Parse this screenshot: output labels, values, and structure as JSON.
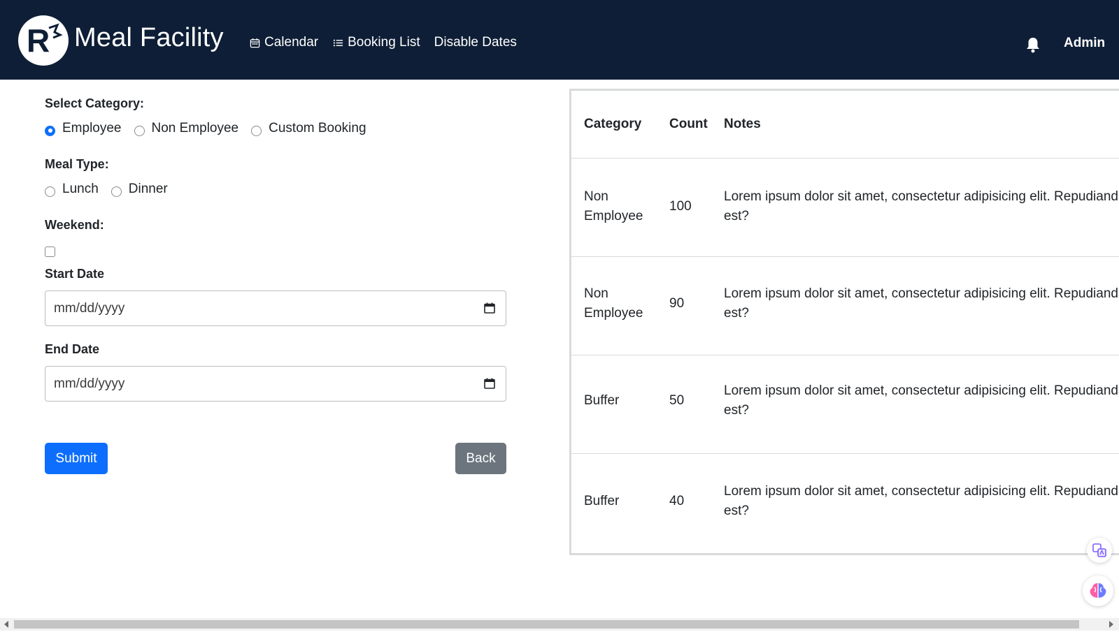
{
  "header": {
    "logo_letter": "R",
    "brand": "Meal Facility",
    "nav": [
      {
        "label": "Calendar",
        "icon": "calendar-icon"
      },
      {
        "label": "Booking List",
        "icon": "list-icon"
      },
      {
        "label": "Disable Dates",
        "icon": ""
      }
    ],
    "user": "Admin",
    "bg_color": "#0e1e36"
  },
  "form": {
    "category_label": "Select Category:",
    "categories": [
      {
        "label": "Employee",
        "checked": true
      },
      {
        "label": "Non Employee",
        "checked": false
      },
      {
        "label": "Custom Booking",
        "checked": false
      }
    ],
    "meal_label": "Meal Type:",
    "meals": [
      {
        "label": "Lunch",
        "checked": false
      },
      {
        "label": "Dinner",
        "checked": false
      }
    ],
    "weekend_label": "Weekend:",
    "weekend_checked": false,
    "start_label": "Start Date",
    "start_value": "mm/dd/yyyy",
    "end_label": "End Date",
    "end_value": "mm/dd/yyyy",
    "submit_label": "Submit",
    "back_label": "Back",
    "primary_color": "#0d6efd",
    "secondary_color": "#6c757d"
  },
  "table": {
    "headers": [
      "Category",
      "Count",
      "Notes"
    ],
    "rows": [
      {
        "category": [
          "Non",
          "Employee"
        ],
        "count": "100",
        "notes": [
          "Lorem ipsum dolor sit amet, consectetur adipisicing elit. Repudiandae",
          "est?"
        ]
      },
      {
        "category": [
          "Non",
          "Employee"
        ],
        "count": "90",
        "notes": [
          "Lorem ipsum dolor sit amet, consectetur adipisicing elit. Repudiandae",
          "est?"
        ]
      },
      {
        "category": [
          "Buffer"
        ],
        "count": "50",
        "notes": [
          "Lorem ipsum dolor sit amet, consectetur adipisicing elit. Repudiandae",
          "est?"
        ]
      },
      {
        "category": [
          "Buffer"
        ],
        "count": "40",
        "notes": [
          "Lorem ipsum dolor sit amet, consectetur adipisicing elit. Repudiandae",
          "est?"
        ]
      }
    ]
  }
}
